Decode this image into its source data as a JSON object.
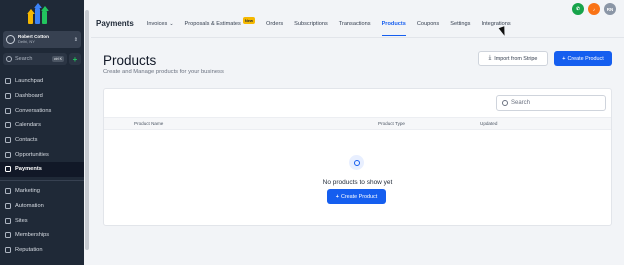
{
  "sidebar": {
    "account_name": "Robert Cotton",
    "account_location": "Delhi, NY",
    "search_placeholder": "Search",
    "search_shortcut": "ctrl K",
    "add_symbol": "+",
    "items": [
      {
        "label": "Launchpad",
        "icon": "rocket-icon"
      },
      {
        "label": "Dashboard",
        "icon": "dashboard-icon"
      },
      {
        "label": "Conversations",
        "icon": "chat-icon"
      },
      {
        "label": "Calendars",
        "icon": "calendar-icon"
      },
      {
        "label": "Contacts",
        "icon": "contacts-icon"
      },
      {
        "label": "Opportunities",
        "icon": "opportunities-icon"
      },
      {
        "label": "Payments",
        "icon": "payments-icon",
        "active": true
      }
    ],
    "items2": [
      {
        "label": "Marketing",
        "icon": "marketing-icon"
      },
      {
        "label": "Automation",
        "icon": "automation-icon"
      },
      {
        "label": "Sites",
        "icon": "sites-icon"
      },
      {
        "label": "Memberships",
        "icon": "memberships-icon"
      },
      {
        "label": "Reputation",
        "icon": "reputation-icon"
      }
    ]
  },
  "topbar": {
    "title": "Payments",
    "tabs": [
      {
        "label": "Invoices",
        "dropdown": true
      },
      {
        "label": "Proposals & Estimates",
        "badge": "New"
      },
      {
        "label": "Orders"
      },
      {
        "label": "Subscriptions"
      },
      {
        "label": "Transactions"
      },
      {
        "label": "Products",
        "active": true
      },
      {
        "label": "Coupons"
      },
      {
        "label": "Settings"
      },
      {
        "label": "Integrations"
      }
    ],
    "avatar_initials": "RN"
  },
  "main": {
    "title": "Products",
    "subtitle": "Create and Manage products for your business",
    "import_label": "Import from Stripe",
    "create_label": "Create Product",
    "table_search_placeholder": "Search",
    "columns": [
      "Product Name",
      "Product Type",
      "Updated"
    ],
    "empty_text": "No products to show yet",
    "empty_create_label": "Create Product"
  },
  "colors": {
    "accent": "#155eef",
    "sidebar_bg": "#1f2937",
    "badge": "#f5b800"
  }
}
